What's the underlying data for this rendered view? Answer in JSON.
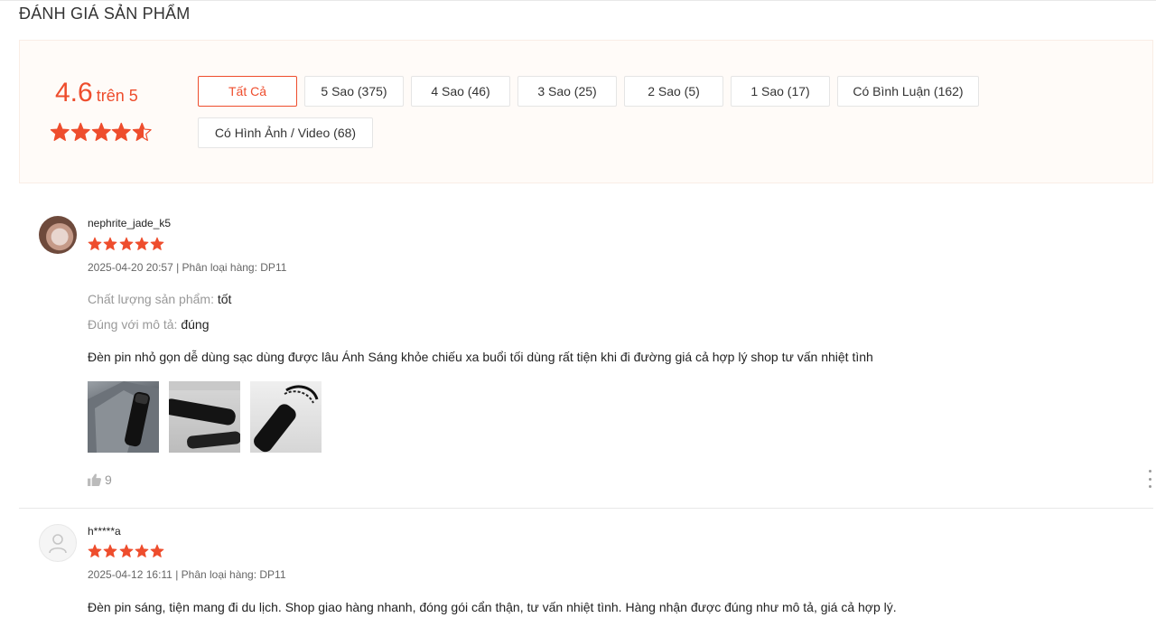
{
  "section": {
    "title": "ĐÁNH GIÁ SẢN PHẨM"
  },
  "summary": {
    "rating": "4.6",
    "rating_suffix": "trên 5",
    "rating_value": 4.6,
    "rating_max": 5,
    "accent_color": "#ee4d2d",
    "filters": [
      {
        "label": "Tất Cả",
        "active": true
      },
      {
        "label": "5 Sao (375)",
        "active": false
      },
      {
        "label": "4 Sao (46)",
        "active": false
      },
      {
        "label": "3 Sao (25)",
        "active": false
      },
      {
        "label": "2 Sao (5)",
        "active": false
      },
      {
        "label": "1 Sao (17)",
        "active": false
      },
      {
        "label": "Có Bình Luận (162)",
        "active": false
      },
      {
        "label": "Có Hình Ảnh / Video (68)",
        "active": false
      }
    ]
  },
  "reviews": [
    {
      "username": "nephrite_jade_k5",
      "stars": 5,
      "meta": "2025-04-20 20:57 | Phân loại hàng: DP11",
      "attributes": [
        {
          "key": "Chất lượng sản phẩm:",
          "value": "tốt"
        },
        {
          "key": "Đúng với mô tả:",
          "value": "đúng"
        }
      ],
      "comment": "Đèn pin nhỏ gọn dễ dùng sạc dùng được lâu Ánh Sáng khỏe chiếu xa buổi tối dùng rất tiện khi đi đường giá cả hợp lý shop tư vấn nhiệt tình",
      "likes": "9",
      "icons": {
        "like": "thumbs-up-icon",
        "more": "more-vertical-icon"
      }
    },
    {
      "username": "h*****a",
      "stars": 5,
      "meta": "2025-04-12 16:11 | Phân loại hàng: DP11",
      "comment": "Đèn pin sáng, tiện mang đi du lịch. Shop giao hàng nhanh, đóng gói cẩn thận, tư vấn nhiệt tình. Hàng nhận được đúng như mô tả, giá cả hợp lý."
    }
  ]
}
